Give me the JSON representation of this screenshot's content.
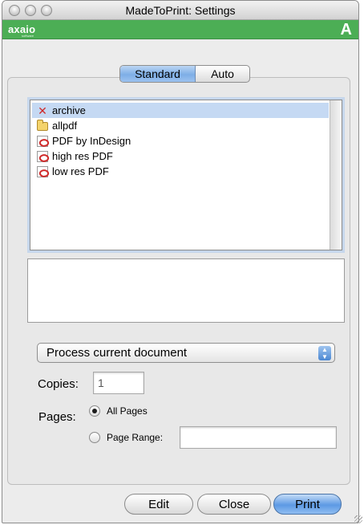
{
  "window": {
    "title": "MadeToPrint: Settings"
  },
  "brand": {
    "logo": "axaio",
    "tagline": "software",
    "mark": "A",
    "color": "#4cae55"
  },
  "tabs": [
    {
      "label": "Standard",
      "selected": true
    },
    {
      "label": "Auto",
      "selected": false
    }
  ],
  "jobs": [
    {
      "label": "archive",
      "icon": "x-icon",
      "selected": true
    },
    {
      "label": "allpdf",
      "icon": "folder-icon",
      "selected": false
    },
    {
      "label": "PDF by InDesign",
      "icon": "pdf-icon",
      "selected": false
    },
    {
      "label": "high res PDF",
      "icon": "pdf-icon",
      "selected": false
    },
    {
      "label": "low res PDF",
      "icon": "pdf-icon",
      "selected": false
    }
  ],
  "process": {
    "selected": "Process current document"
  },
  "copies": {
    "label": "Copies:",
    "value": "1"
  },
  "pages": {
    "label": "Pages:",
    "all_label": "All Pages",
    "range_label": "Page Range:",
    "range_value": "",
    "selected": "all"
  },
  "buttons": {
    "edit": "Edit",
    "close": "Close",
    "print": "Print"
  }
}
